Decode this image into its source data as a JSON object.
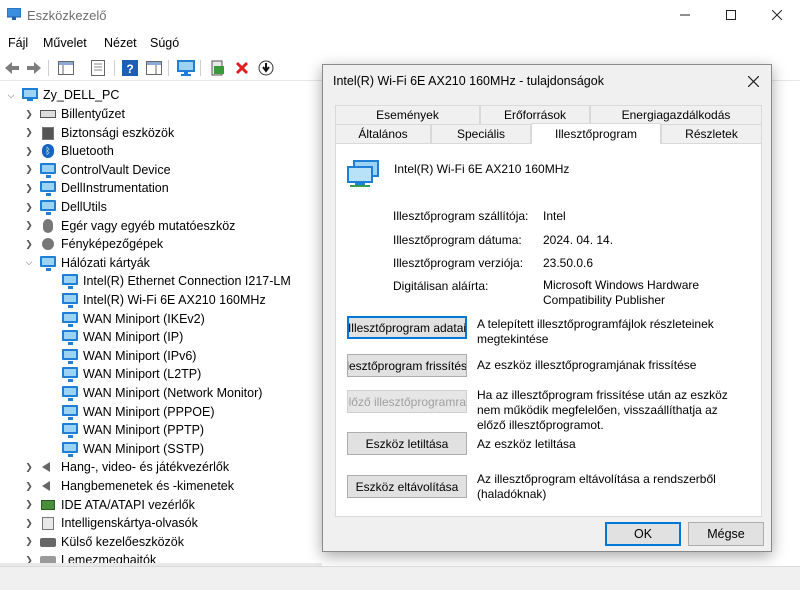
{
  "window": {
    "title": "Eszközkezelő"
  },
  "menu": [
    "Fájl",
    "Művelet",
    "Nézet",
    "Súgó"
  ],
  "tree": {
    "root": "Zy_DELL_PC",
    "items": [
      {
        "label": "Billentyűzet",
        "level": 1,
        "icon": "keyboard-icon",
        "expanded": false
      },
      {
        "label": "Biztonsági eszközök",
        "level": 1,
        "icon": "security-device-icon",
        "expanded": false
      },
      {
        "label": "Bluetooth",
        "level": 1,
        "icon": "bluetooth-icon",
        "expanded": false
      },
      {
        "label": "ControlVault Device",
        "level": 1,
        "icon": "monitor-icon",
        "expanded": false
      },
      {
        "label": "DellInstrumentation",
        "level": 1,
        "icon": "monitor-icon",
        "expanded": false
      },
      {
        "label": "DellUtils",
        "level": 1,
        "icon": "monitor-icon",
        "expanded": false
      },
      {
        "label": "Egér vagy egyéb mutatóeszköz",
        "level": 1,
        "icon": "mouse-icon",
        "expanded": false
      },
      {
        "label": "Fényképezőgépek",
        "level": 1,
        "icon": "camera-icon",
        "expanded": false
      },
      {
        "label": "Hálózati kártyák",
        "level": 1,
        "icon": "network-adapter-icon",
        "expanded": true
      },
      {
        "label": "Intel(R) Ethernet Connection I217-LM",
        "level": 2,
        "icon": "network-adapter-icon"
      },
      {
        "label": "Intel(R) Wi-Fi 6E AX210 160MHz",
        "level": 2,
        "icon": "network-adapter-icon"
      },
      {
        "label": "WAN Miniport (IKEv2)",
        "level": 2,
        "icon": "network-adapter-icon"
      },
      {
        "label": "WAN Miniport (IP)",
        "level": 2,
        "icon": "network-adapter-icon"
      },
      {
        "label": "WAN Miniport (IPv6)",
        "level": 2,
        "icon": "network-adapter-icon"
      },
      {
        "label": "WAN Miniport (L2TP)",
        "level": 2,
        "icon": "network-adapter-icon"
      },
      {
        "label": "WAN Miniport (Network Monitor)",
        "level": 2,
        "icon": "network-adapter-icon"
      },
      {
        "label": "WAN Miniport (PPPOE)",
        "level": 2,
        "icon": "network-adapter-icon"
      },
      {
        "label": "WAN Miniport (PPTP)",
        "level": 2,
        "icon": "network-adapter-icon"
      },
      {
        "label": "WAN Miniport (SSTP)",
        "level": 2,
        "icon": "network-adapter-icon"
      },
      {
        "label": "Hang-, video- és játékvezérlők",
        "level": 1,
        "icon": "speaker-icon",
        "expanded": false
      },
      {
        "label": "Hangbemenetek és -kimenetek",
        "level": 1,
        "icon": "speaker-icon",
        "expanded": false
      },
      {
        "label": "IDE ATA/ATAPI vezérlők",
        "level": 1,
        "icon": "chip-icon",
        "expanded": false
      },
      {
        "label": "Intelligenskártya-olvasók",
        "level": 1,
        "icon": "card-reader-icon",
        "expanded": false
      },
      {
        "label": "Külső kezelőeszközök",
        "level": 1,
        "icon": "device-icon",
        "expanded": false
      },
      {
        "label": "Lemezmeghajtók",
        "level": 1,
        "icon": "disk-icon",
        "expanded": false
      }
    ]
  },
  "dialog": {
    "title": "Intel(R) Wi-Fi 6E AX210 160MHz - tulajdonságok",
    "tabs_top": [
      "Események",
      "Erőforrások",
      "Energiagazdálkodás"
    ],
    "tabs_bottom": [
      "Általános",
      "Speciális",
      "Illesztőprogram",
      "Részletek"
    ],
    "active_tab": "Illesztőprogram",
    "device_name": "Intel(R) Wi-Fi 6E AX210 160MHz",
    "fields": [
      {
        "label": "Illesztőprogram szállítója:",
        "value": "Intel"
      },
      {
        "label": "Illesztőprogram dátuma:",
        "value": "2024. 04. 14."
      },
      {
        "label": "Illesztőprogram verziója:",
        "value": "23.50.0.6"
      },
      {
        "label": "Digitálisan aláírta:",
        "value": "Microsoft Windows Hardware Compatibility Publisher"
      }
    ],
    "actions": [
      {
        "button": "Illesztőprogram adatai",
        "description": "A telepített illesztőprogramfájlok részleteinek megtekintése",
        "state": "focused"
      },
      {
        "button": "Illesztőprogram frissítése",
        "description": "Az eszköz illesztőprogramjának frissítése",
        "state": "normal"
      },
      {
        "button": "Visszaállás az előző illesztőprogramra",
        "description": "Ha az illesztőprogram frissítése után az eszköz nem működik megfelelően, visszaállíthatja az előző illesztőprogramot.",
        "state": "disabled"
      },
      {
        "button": "Eszköz letiltása",
        "description": "Az eszköz letiltása",
        "state": "normal"
      },
      {
        "button": "Eszköz eltávolítása",
        "description": "Az illesztőprogram eltávolítása a rendszerből (haladóknak)",
        "state": "normal"
      }
    ],
    "ok": "OK",
    "cancel": "Mégse"
  }
}
